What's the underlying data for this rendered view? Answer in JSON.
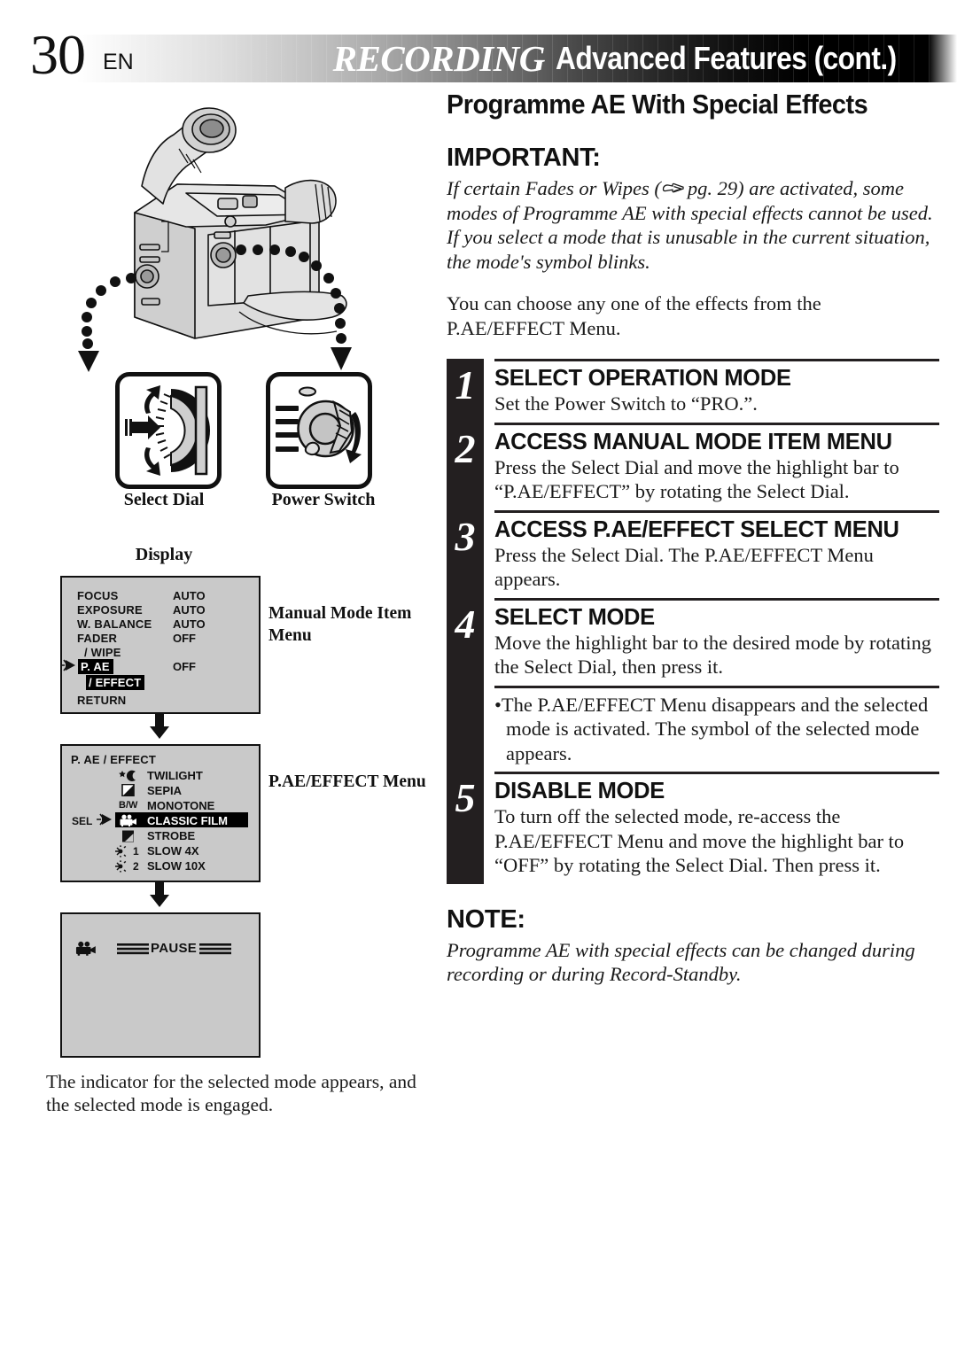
{
  "page": {
    "number": "30",
    "language": "EN"
  },
  "header": {
    "title_primary": "RECORDING",
    "title_secondary": "Advanced Features (cont.)"
  },
  "main": {
    "section_title": "Programme AE With Special Effects",
    "important_label": "IMPORTANT:",
    "important_text_before": "If certain Fades or Wipes (",
    "important_page_ref": "pg. 29",
    "important_text_after": ") are activated, some modes of Programme AE with special effects cannot be used. If you select a mode that is unusable in the current situation, the mode's symbol blinks.",
    "intro_text": "You can choose any one of the effects from the P.AE/EFFECT Menu.",
    "note_label": "NOTE:",
    "note_text": "Programme AE with special effects can be changed during recording or during Record-Standby."
  },
  "steps": [
    {
      "number": "1",
      "heading": "SELECT OPERATION MODE",
      "text": "Set the Power Switch to “PRO.”."
    },
    {
      "number": "2",
      "heading": "ACCESS MANUAL MODE ITEM MENU",
      "text": "Press the Select Dial and move the highlight bar to “P.AE/EFFECT” by rotating the Select Dial."
    },
    {
      "number": "3",
      "heading": "ACCESS P.AE/EFFECT SELECT MENU",
      "text": "Press the Select Dial. The P.AE/EFFECT Menu appears."
    },
    {
      "number": "4",
      "heading": "SELECT MODE",
      "text": "Move the highlight bar to the desired mode by rotating the Select Dial, then press it.",
      "bullet": "The P.AE/EFFECT Menu disappears and the selected mode is activated. The symbol of the selected mode appears."
    },
    {
      "number": "5",
      "heading": "DISABLE MODE",
      "text": "To turn off the selected mode, re-access the P.AE/EFFECT Menu and move the highlight bar to “OFF” by rotating the Select Dial. Then press it."
    }
  ],
  "left": {
    "select_dial_caption": "Select Dial",
    "power_switch_caption": "Power Switch",
    "display_label": "Display",
    "manual_menu_caption": "Manual Mode Item Menu",
    "pae_menu_caption": "P.AE/EFFECT Menu",
    "bottom_caption": "The indicator for the selected mode appears, and the selected mode is engaged."
  },
  "manual_menu": {
    "rows": [
      {
        "label": "FOCUS",
        "value": "AUTO",
        "highlight": false
      },
      {
        "label": "EXPOSURE",
        "value": "AUTO",
        "highlight": false
      },
      {
        "label": "W. BALANCE",
        "value": "AUTO",
        "highlight": false
      },
      {
        "label": "FADER",
        "value": "OFF",
        "highlight": false
      },
      {
        "label": "/ WIPE",
        "value": "",
        "highlight": false
      },
      {
        "label": "P. AE",
        "value": "OFF",
        "highlight": true
      },
      {
        "label": "/ EFFECT",
        "value": "",
        "highlight": true
      }
    ],
    "return_label": "RETURN"
  },
  "pae_menu": {
    "title": "P. AE / EFFECT",
    "sel_marker": "SEL",
    "items": [
      {
        "label": "TWILIGHT",
        "icon": "twilight-icon",
        "selected": false
      },
      {
        "label": "SEPIA",
        "icon": "sepia-icon",
        "selected": false
      },
      {
        "label": "MONOTONE",
        "icon": "bw-icon",
        "icon_text": "B/W",
        "selected": false
      },
      {
        "label": "CLASSIC FILM",
        "icon": "movie-camera-icon",
        "selected": true
      },
      {
        "label": "STROBE",
        "icon": "strobe-icon",
        "selected": false
      },
      {
        "label": "SLOW 4X",
        "icon": "slow-1-icon",
        "icon_text": "1",
        "selected": false
      },
      {
        "label": "SLOW 10X",
        "icon": "slow-2-icon",
        "icon_text": "2",
        "selected": false
      }
    ]
  },
  "pause_screen": {
    "indicator_icon": "movie-camera-icon",
    "status_text": "PAUSE"
  },
  "colors": {
    "ink": "#231f20",
    "osd_background": "#c9c9c9",
    "highlight_background": "#000000",
    "highlight_text": "#ffffff"
  }
}
